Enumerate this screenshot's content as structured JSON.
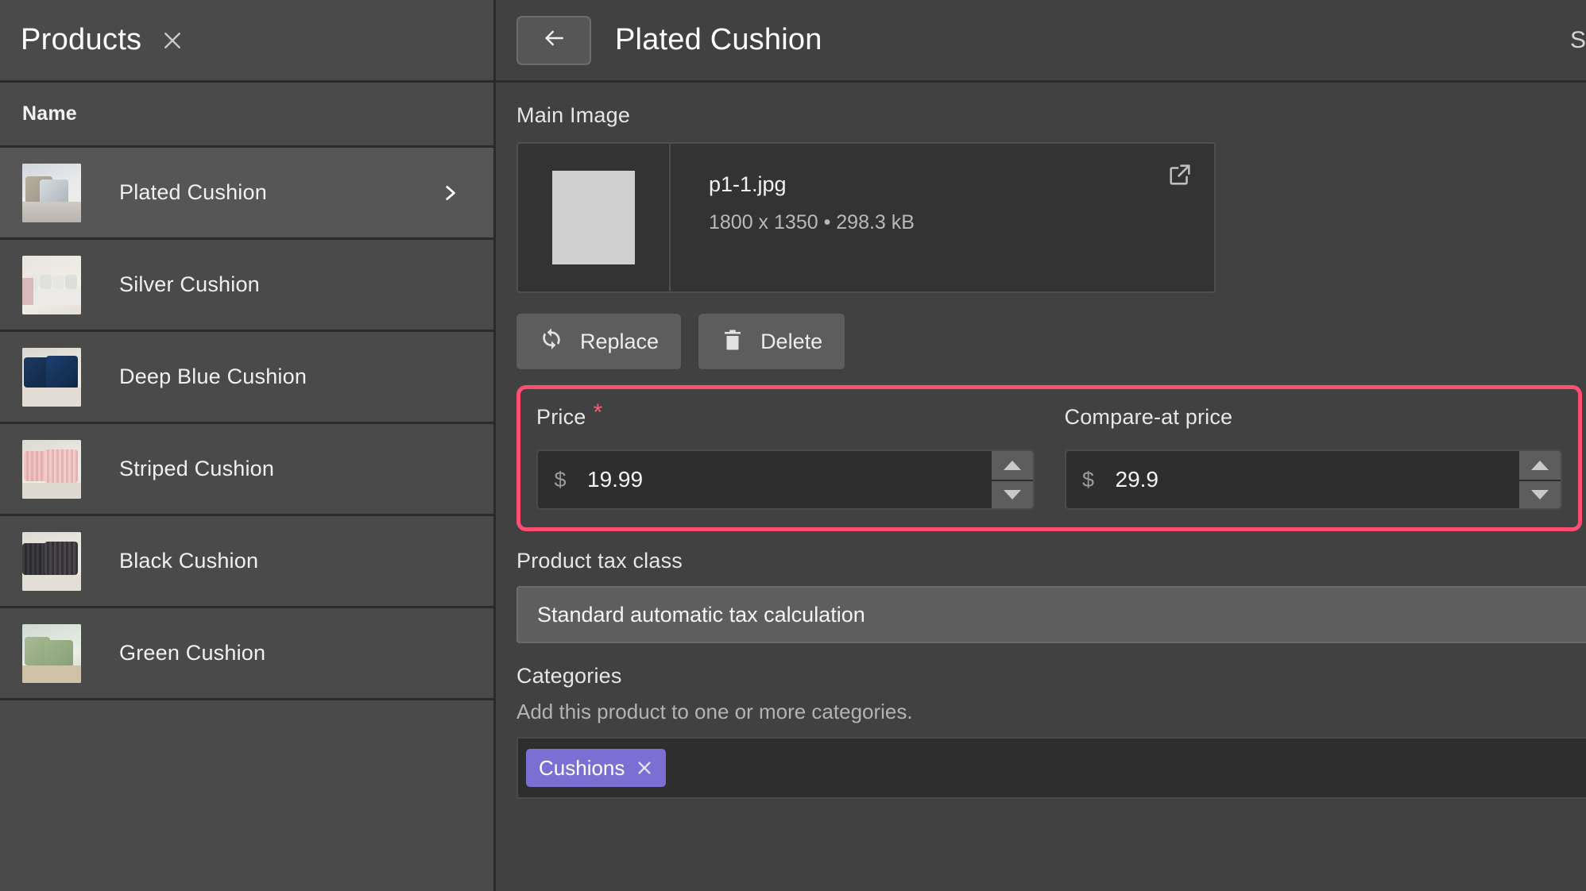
{
  "sidebar": {
    "title": "Products",
    "close_icon": "close-icon",
    "column_header": "Name",
    "items": [
      {
        "label": "Plated Cushion",
        "selected": true,
        "thumb": "plated",
        "chevron": "chevron-right-icon"
      },
      {
        "label": "Silver Cushion",
        "selected": false,
        "thumb": "silver",
        "chevron": ""
      },
      {
        "label": "Deep Blue Cushion",
        "selected": false,
        "thumb": "blue",
        "chevron": ""
      },
      {
        "label": "Striped Cushion",
        "selected": false,
        "thumb": "pink",
        "chevron": ""
      },
      {
        "label": "Black Cushion",
        "selected": false,
        "thumb": "black",
        "chevron": ""
      },
      {
        "label": "Green Cushion",
        "selected": false,
        "thumb": "green",
        "chevron": ""
      }
    ]
  },
  "header": {
    "back_icon": "arrow-left-icon",
    "title": "Plated Cushion",
    "right_partial": "S"
  },
  "main_image": {
    "label": "Main Image",
    "file_name": "p1-1.jpg",
    "file_meta": "1800 x 1350 • 298.3 kB",
    "open_icon": "external-link-icon",
    "replace_label": "Replace",
    "replace_icon": "refresh-icon",
    "delete_label": "Delete",
    "delete_icon": "trash-icon"
  },
  "price": {
    "label": "Price",
    "required_marker": "*",
    "currency": "$",
    "value": "19.99",
    "increment_icon": "caret-up-icon",
    "decrement_icon": "caret-down-icon",
    "highlight_color": "#ff4d74"
  },
  "compare_price": {
    "label": "Compare-at price",
    "currency": "$",
    "value": "29.9",
    "increment_icon": "caret-up-icon",
    "decrement_icon": "caret-down-icon"
  },
  "tax": {
    "label": "Product tax class",
    "selected": "Standard automatic tax calculation"
  },
  "categories": {
    "label": "Categories",
    "help": "Add this product to one or more categories.",
    "tags": [
      {
        "label": "Cushions",
        "remove_icon": "close-icon",
        "color": "#7c6fd4"
      }
    ]
  }
}
